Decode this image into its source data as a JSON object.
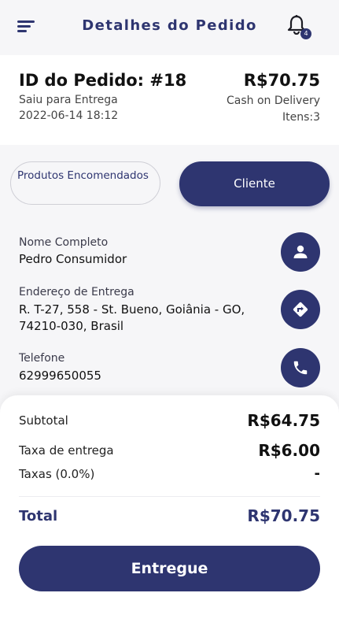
{
  "header": {
    "title": "Detalhes do Pedido",
    "notification_count": "4"
  },
  "order": {
    "id_label": "ID do Pedido: #18",
    "status": "Saiu para Entrega",
    "datetime": "2022-06-14 18:12",
    "total": "R$70.75",
    "payment_method": "Cash on Delivery",
    "items": "Itens:3"
  },
  "tabs": {
    "products": "Produtos Encomendados",
    "client": "Cliente"
  },
  "customer": {
    "name_label": "Nome Completo",
    "name": "Pedro Consumidor",
    "address_label": "Endereço de Entrega",
    "address": "R. T-27, 558 - St. Bueno, Goiânia - GO, 74210-030, Brasil",
    "phone_label": "Telefone",
    "phone": "62999650055"
  },
  "summary": {
    "subtotal_label": "Subtotal",
    "subtotal": "R$64.75",
    "delivery_fee_label": "Taxa de entrega",
    "delivery_fee": "R$6.00",
    "taxes_label": "Taxas (0.0%)",
    "taxes": "-",
    "total_label": "Total",
    "total": "R$70.75"
  },
  "actions": {
    "delivered": "Entregue"
  },
  "colors": {
    "primary": "#2e3570",
    "background": "#f6f6f8",
    "card": "#ffffff"
  }
}
